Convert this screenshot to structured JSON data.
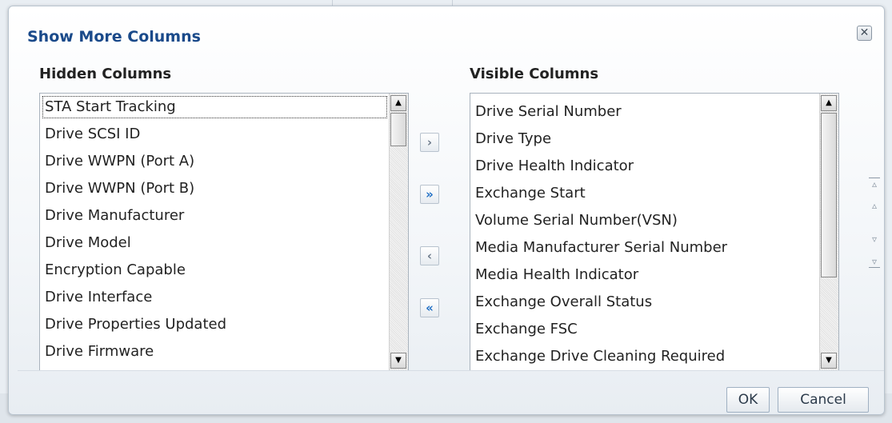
{
  "dialog": {
    "title": "Show More Columns",
    "close_icon": "close-icon",
    "ok_label": "OK",
    "cancel_label": "Cancel"
  },
  "hidden_columns": {
    "heading": "Hidden Columns",
    "items": [
      "STA Start Tracking",
      "Drive SCSI ID",
      "Drive WWPN (Port A)",
      "Drive WWPN (Port B)",
      "Drive Manufacturer",
      "Drive Model",
      "Encryption Capable",
      "Drive Interface",
      "Drive Properties Updated",
      "Drive Firmware"
    ]
  },
  "visible_columns": {
    "heading": "Visible Columns",
    "items": [
      "Drive Serial Number",
      "Drive Type",
      "Drive Health Indicator",
      "Exchange Start",
      "Volume Serial Number(VSN)",
      "Media Manufacturer Serial Number",
      "Media Health Indicator",
      "Exchange Overall Status",
      "Exchange FSC",
      "Exchange Drive Cleaning Required"
    ]
  },
  "shuttle": {
    "move_icon": "›",
    "move_all_icon": "»",
    "remove_icon": "‹",
    "remove_all_icon": "«"
  },
  "reorder": {
    "top_icon": "▵",
    "up_icon": "▵",
    "down_icon": "▿",
    "bottom_icon": "▿"
  }
}
